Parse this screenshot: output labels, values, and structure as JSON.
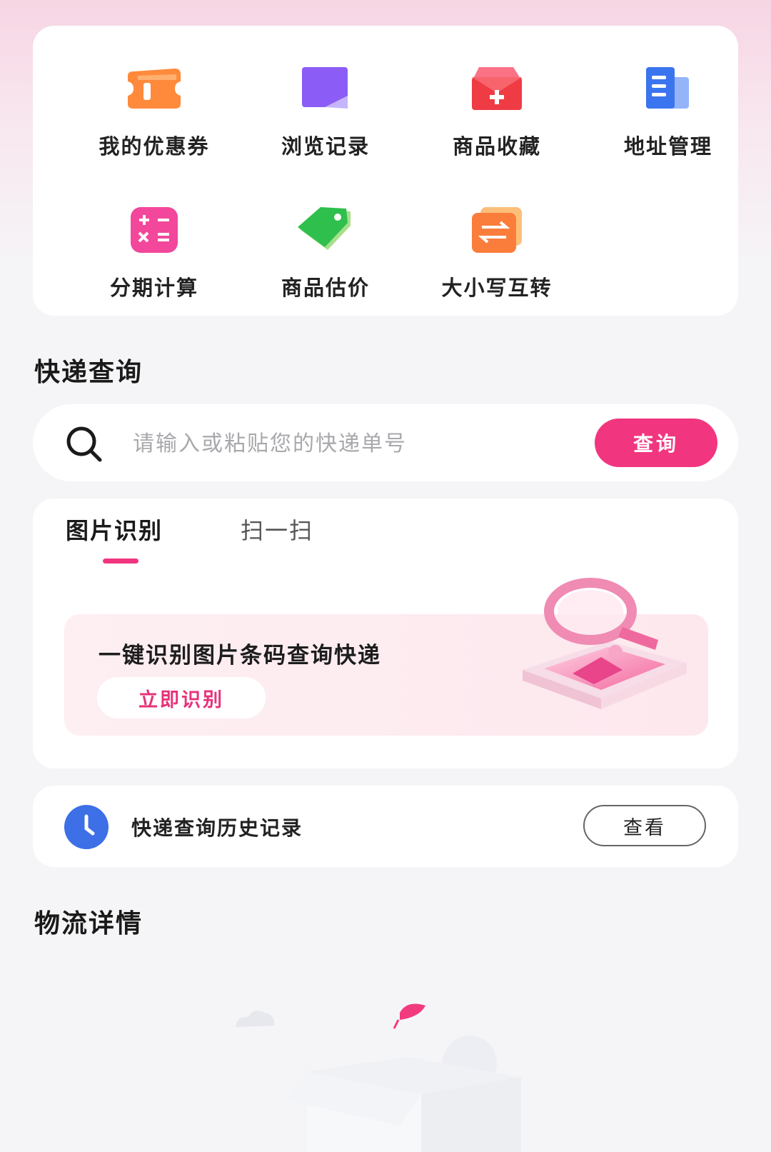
{
  "tools": {
    "items": [
      {
        "label": "我的优惠券",
        "icon": "coupon-icon"
      },
      {
        "label": "浏览记录",
        "icon": "history-bookmark-icon"
      },
      {
        "label": "商品收藏",
        "icon": "favorite-box-icon"
      },
      {
        "label": "地址管理",
        "icon": "address-book-icon"
      },
      {
        "label": "分期计算",
        "icon": "calculator-icon"
      },
      {
        "label": "商品估价",
        "icon": "price-tag-icon"
      },
      {
        "label": "大小写互转",
        "icon": "case-convert-icon"
      }
    ]
  },
  "express": {
    "section_title": "快递查询",
    "search": {
      "placeholder": "请输入或粘贴您的快递单号",
      "button_label": "查询"
    },
    "tabs": [
      {
        "label": "图片识别",
        "active": true
      },
      {
        "label": "扫一扫",
        "active": false
      }
    ],
    "recognition": {
      "headline": "一键识别图片条码查询快递",
      "button_label": "立即识别"
    },
    "history": {
      "label": "快递查询历史记录",
      "button_label": "查看"
    }
  },
  "logistics": {
    "section_title": "物流详情"
  },
  "colors": {
    "accent": "#f1357f",
    "clock": "#3d6fe6"
  }
}
